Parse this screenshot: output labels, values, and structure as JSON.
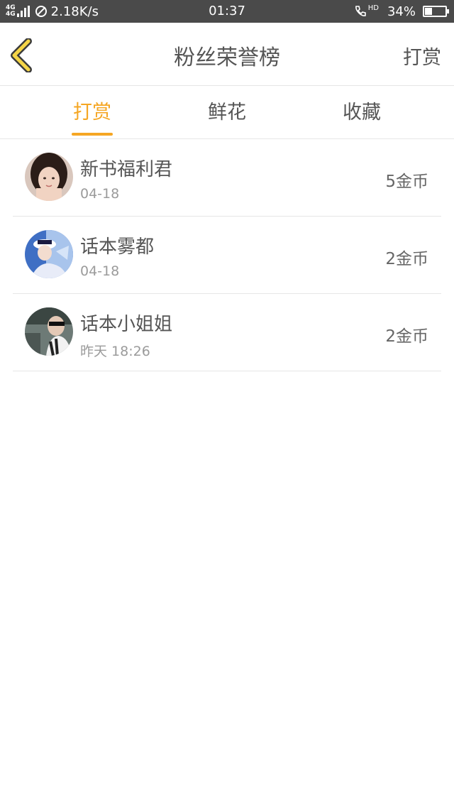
{
  "status_bar": {
    "network_top": "4G",
    "network_bottom": "4G",
    "speed": "2.18K/s",
    "time": "01:37",
    "hd": "HD",
    "battery": "34%",
    "battery_level": 0.34,
    "icons": [
      "signal-icon",
      "do-not-disturb-icon",
      "hd-call-icon",
      "battery-icon"
    ]
  },
  "header": {
    "title": "粉丝荣誉榜",
    "action_label": "打赏",
    "back_icon": "chevron-left-icon"
  },
  "tabs": [
    {
      "label": "打赏",
      "active": true
    },
    {
      "label": "鲜花",
      "active": false
    },
    {
      "label": "收藏",
      "active": false
    }
  ],
  "list": [
    {
      "name": "新书福利君",
      "time": "04-18",
      "amount": "5金币"
    },
    {
      "name": "话本雾都",
      "time": "04-18",
      "amount": "2金币"
    },
    {
      "name": "话本小姐姐",
      "time": "昨天 18:26",
      "amount": "2金币"
    }
  ],
  "colors": {
    "accent": "#f5a623",
    "back_icon": "#f5d547",
    "status_bar_bg": "#4a4a4a",
    "text": "#555555",
    "subtext": "#9b9b9b"
  }
}
